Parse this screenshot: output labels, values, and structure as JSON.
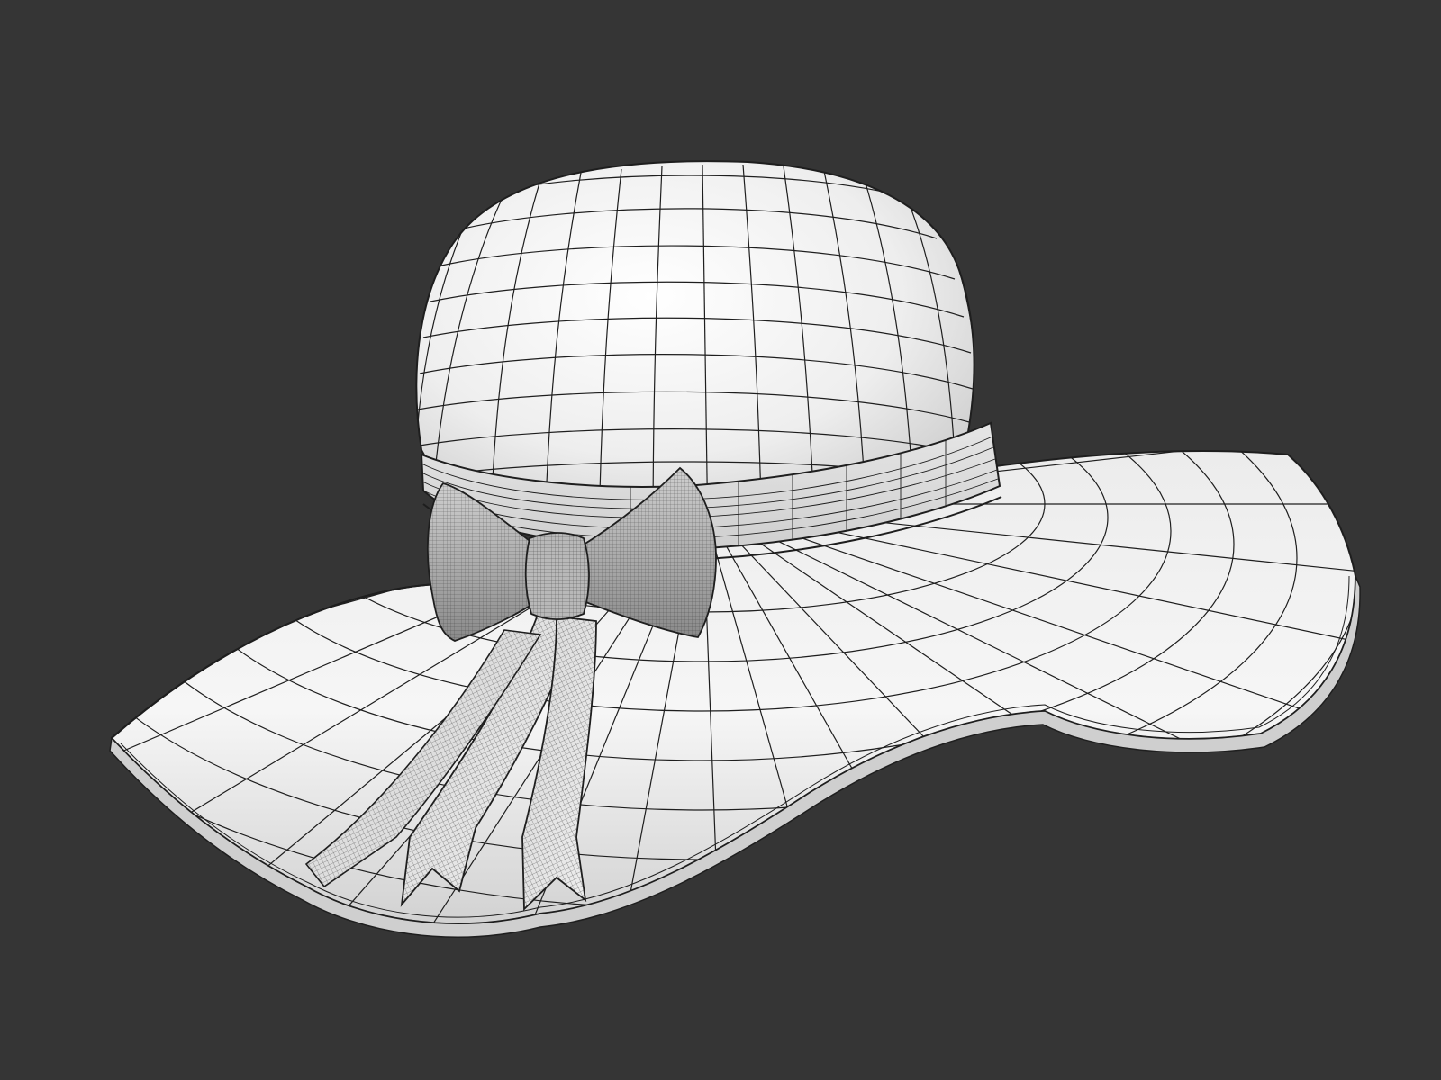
{
  "scene": {
    "subject": "wide-brim-hat",
    "render_style": "wireframe-over-clay",
    "colors": {
      "background": "#353535",
      "surface_light": "#f2f2f2",
      "surface_mid": "#dcdcdc",
      "surface_shadow": "#a9a9a9",
      "wire": "#1e1e1e",
      "bow_light": "#d6d6d6",
      "bow_dark": "#7b7b7b"
    },
    "parts": [
      "brim",
      "crown",
      "hatband",
      "bow",
      "ribbon-tails"
    ]
  }
}
